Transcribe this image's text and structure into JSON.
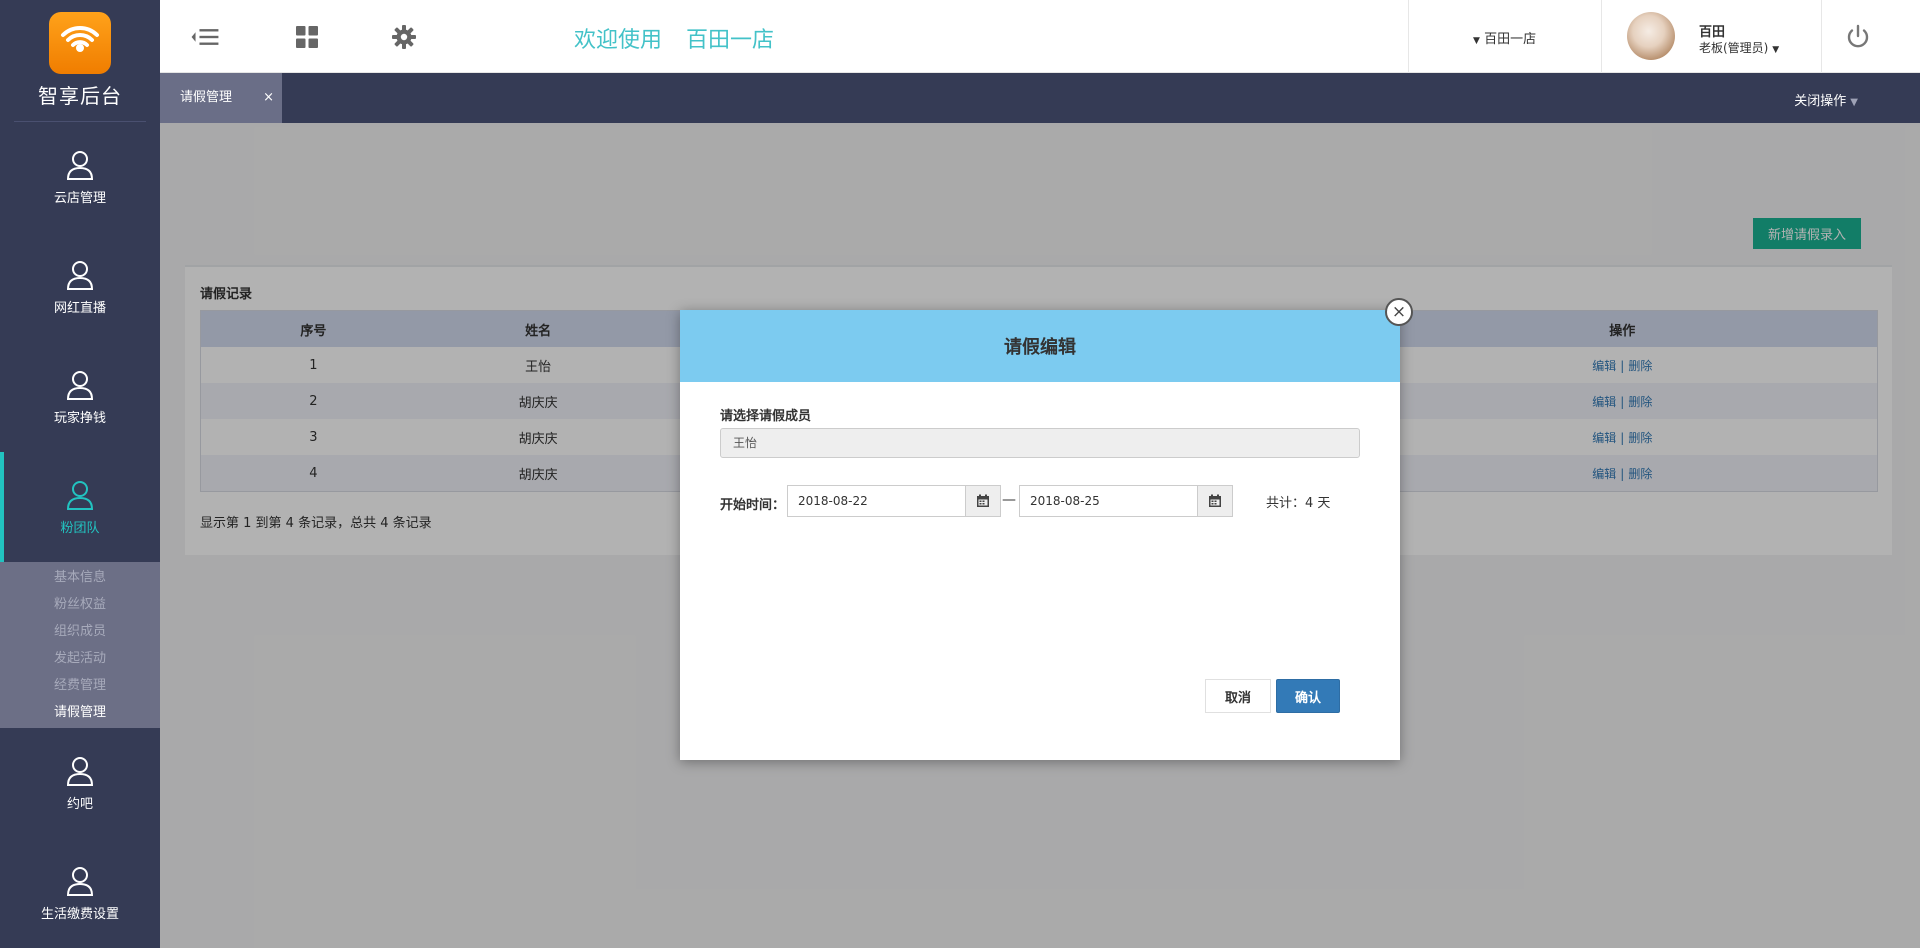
{
  "brand": {
    "name": "智享后台",
    "accent": "#22c3c0",
    "sidebar_bg": "#353b55"
  },
  "sidebar": {
    "items": [
      {
        "label": "云店管理",
        "icon": "user-icon"
      },
      {
        "label": "网红直播",
        "icon": "user-icon"
      },
      {
        "label": "玩家挣钱",
        "icon": "user-icon"
      },
      {
        "label": "粉团队",
        "icon": "user-icon",
        "active": true
      },
      {
        "label": "约吧",
        "icon": "user-icon"
      },
      {
        "label": "生活缴费设置",
        "icon": "user-icon"
      }
    ],
    "subitems": [
      "基本信息",
      "粉丝权益",
      "组织成员",
      "发起活动",
      "经费管理",
      "请假管理"
    ],
    "active_sub": "请假管理"
  },
  "header": {
    "welcome": "欢迎使用",
    "store": "百田一店",
    "store_selector": "百田一店",
    "user_name": "百田",
    "user_role": "老板(管理员)"
  },
  "tabs": {
    "current": "请假管理",
    "close_symbol": "×",
    "close_ops": "关闭操作"
  },
  "main": {
    "add_button": "新增请假录入",
    "panel_title": "请假记录",
    "columns": [
      "序号",
      "姓名",
      "",
      "操作"
    ],
    "rows": [
      {
        "no": "1",
        "name": "王怡"
      },
      {
        "no": "2",
        "name": "胡庆庆"
      },
      {
        "no": "3",
        "name": "胡庆庆"
      },
      {
        "no": "4",
        "name": "胡庆庆"
      }
    ],
    "op_edit": "编辑",
    "op_sep": "|",
    "op_delete": "删除",
    "paging": "显示第 1 到第 4 条记录，总共 4 条记录"
  },
  "modal": {
    "title": "请假编辑",
    "member_label": "请选择请假成员",
    "member_value": "王怡",
    "time_label": "开始时间：",
    "start_date": "2018-08-22",
    "end_date": "2018-08-25",
    "dash": "—",
    "total": "共计：4 天",
    "cancel": "取消",
    "confirm": "确认",
    "close_symbol": "×"
  }
}
